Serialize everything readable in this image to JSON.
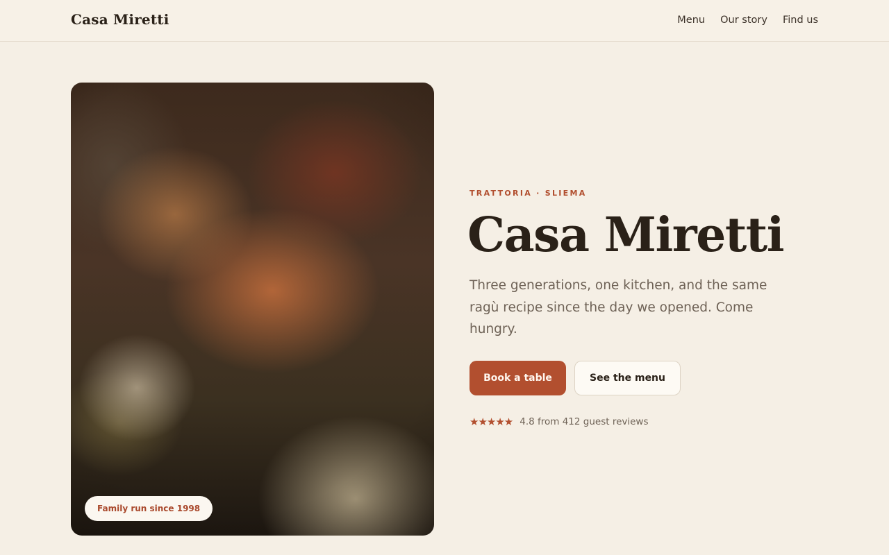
{
  "header": {
    "brand": "Casa Miretti",
    "nav": [
      "Menu",
      "Our story",
      "Find us"
    ]
  },
  "hero": {
    "photo_badge": "Family run since 1998",
    "eyebrow": "TRATTORIA · SLIEMA",
    "title": "Casa Miretti",
    "lede": "Three generations, one kitchen, and the same ragù recipe since the day we opened. Come hungry.",
    "primary_cta": "Book a table",
    "secondary_cta": "See the menu",
    "rating": {
      "stars_glyph": "★★★★★",
      "stars": 5,
      "text": "4.8 from 412 guest reviews"
    }
  },
  "colors": {
    "accent": "#b24f2f",
    "background": "#f5efe5",
    "ink": "#2a2118"
  },
  "icons": {
    "rating": "star-icon"
  }
}
